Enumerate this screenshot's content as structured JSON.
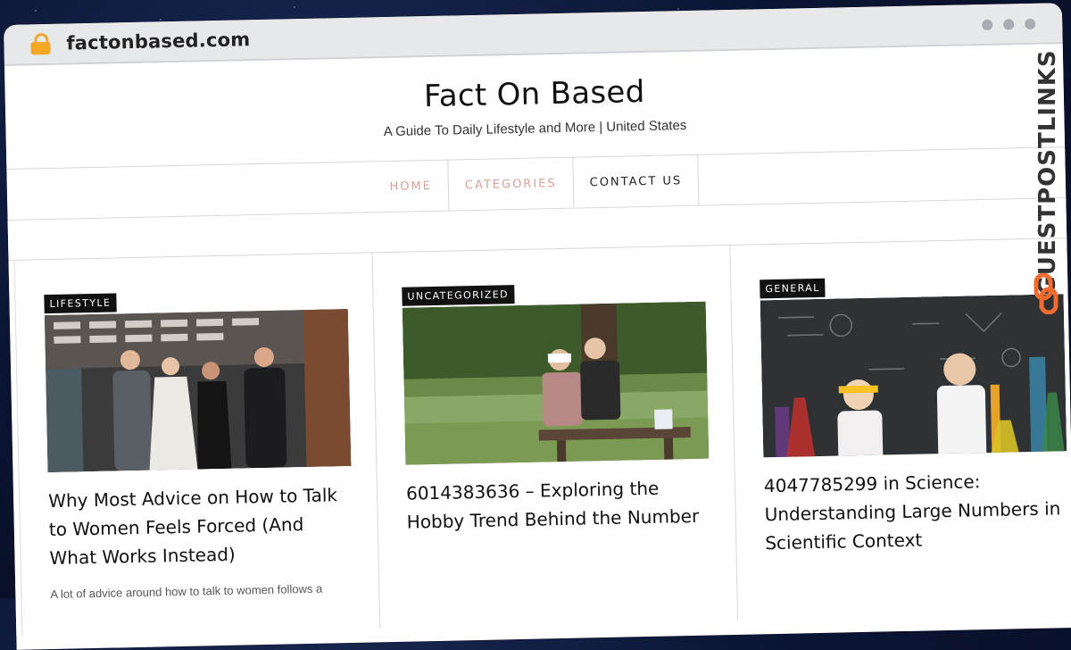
{
  "browser": {
    "url": "factonbased.com"
  },
  "site": {
    "title": "Fact On Based",
    "tagline": "A Guide To Daily Lifestyle and More | United States"
  },
  "nav": {
    "items": [
      {
        "label": "HOME",
        "state": "active"
      },
      {
        "label": "CATEGORIES",
        "state": "active"
      },
      {
        "label": "CONTACT US",
        "state": "plain"
      }
    ]
  },
  "posts": [
    {
      "category": "LIFESTYLE",
      "title": "Why Most Advice on How to Talk to Women Feels Forced (And What Works Instead)",
      "excerpt": "A lot of advice around how to talk to women follows a"
    },
    {
      "category": "UNCATEGORIZED",
      "title": "6014383636 – Exploring the Hobby Trend Behind the Number",
      "excerpt": ""
    },
    {
      "category": "GENERAL",
      "title": "4047785299 in Science: Understanding Large Numbers in Scientific Context",
      "excerpt": ""
    }
  ],
  "watermark": {
    "text": "GUESTPOSTLINKS"
  },
  "colors": {
    "accent_nav": "#d9a094",
    "badge_bg": "#111111",
    "brand_orange": "#f26a2e",
    "lock": "#f5a623"
  }
}
